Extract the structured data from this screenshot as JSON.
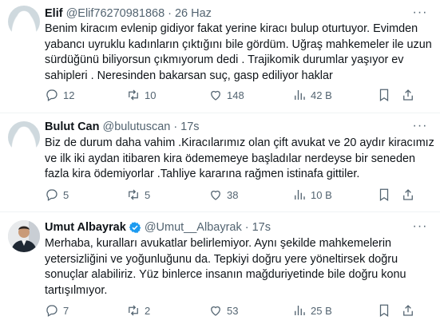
{
  "tweets": [
    {
      "name": "Elif",
      "handle": "@Elif76270981868",
      "separator": "·",
      "time": "26 Haz",
      "text": "Benim kiracım evlenip gidiyor fakat yerine kiracı bulup oturtuyor. Evimden\nyabancı uyruklu kadınların çıktığını bile gördüm. Uğraş mahkemeler ile uzun\nsürdüğünü biliyorsun çıkmıyorum dedi . Trajikomik durumlar yaşıyor ev\nsahipleri . Neresinden bakarsan suç, gasp ediliyor haklar",
      "replies": "12",
      "retweets": "10",
      "likes": "148",
      "views": "42 B"
    },
    {
      "name": "Bulut Can",
      "handle": "@bulutuscan",
      "separator": "·",
      "time": "17s",
      "text": "Biz de durum daha vahim .Kiracılarımız olan çift avukat ve 20 aydır kiracımız\nve ilk iki aydan itibaren kira ödememeye başladılar nerdeyse bir seneden\nfazla kira ödemiyorlar .Tahliye kararına  rağmen istinafa gittiler.",
      "replies": "5",
      "retweets": "5",
      "likes": "38",
      "views": "10 B"
    },
    {
      "name": "Umut Albayrak",
      "handle": "@Umut__Albayrak",
      "separator": "·",
      "time": "17s",
      "text": "Merhaba, kuralları avukatlar belirlemiyor. Aynı şekilde mahkemelerin\nyetersizliğini ve yoğunluğunu da. Tepkiyi doğru yere yöneltirsek doğru\nsonuçlar alabiliriz. Yüz binlerce insanın mağduriyetinde bile doğru konu\ntartışılmıyor.",
      "replies": "7",
      "retweets": "2",
      "likes": "53",
      "views": "25 B",
      "verified": true
    }
  ],
  "more_label": "···",
  "colors": {
    "text": "#0f1419",
    "secondary": "#536471",
    "divider": "#eff3f4",
    "verified": "#1d9bf0"
  }
}
